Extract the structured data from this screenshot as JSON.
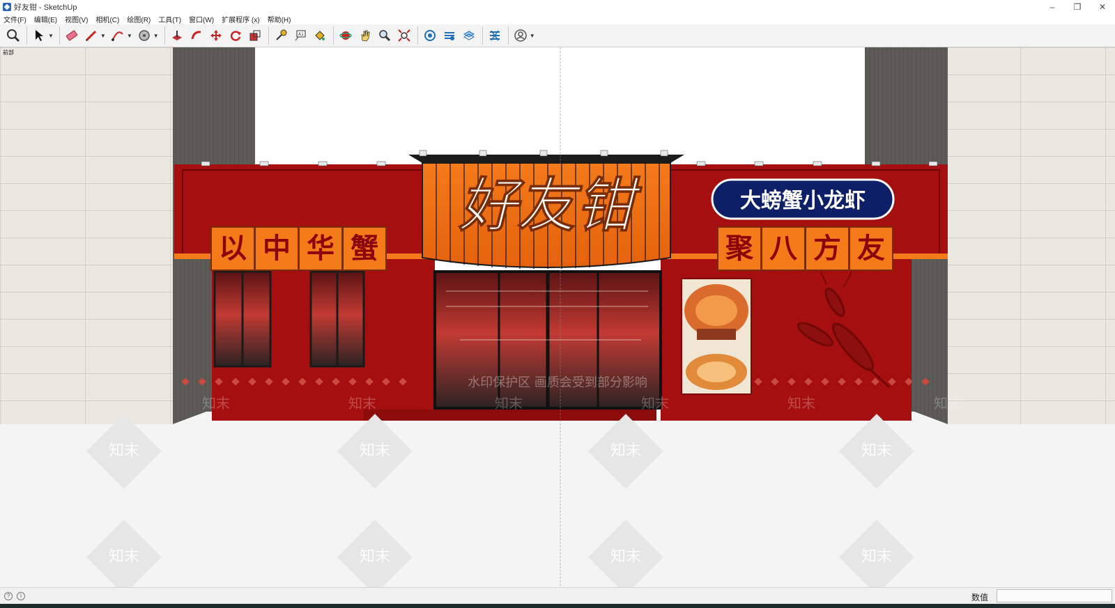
{
  "window": {
    "title": "好友钳 - SketchUp"
  },
  "menu": [
    "文件(F)",
    "编辑(E)",
    "视图(V)",
    "相机(C)",
    "绘图(R)",
    "工具(T)",
    "窗口(W)",
    "扩展程序 (x)",
    "帮助(H)"
  ],
  "viewport": {
    "scene_label": "前部"
  },
  "storefront": {
    "brand": "好友钳",
    "left_tiles": [
      "以",
      "中",
      "华",
      "蟹"
    ],
    "right_tiles": [
      "聚",
      "八",
      "方",
      "友"
    ],
    "oval_sign": "大螃蟹小龙虾"
  },
  "watermark": {
    "notice": "水印保护区  画质会受到部分影响",
    "mark": "知末"
  },
  "statusbar": {
    "measurements_label": "数值",
    "measurements_value": ""
  },
  "colors": {
    "facade_red": "#a50f0f",
    "sign_orange": "#f47a1a",
    "oval_navy": "#0d1f66"
  }
}
